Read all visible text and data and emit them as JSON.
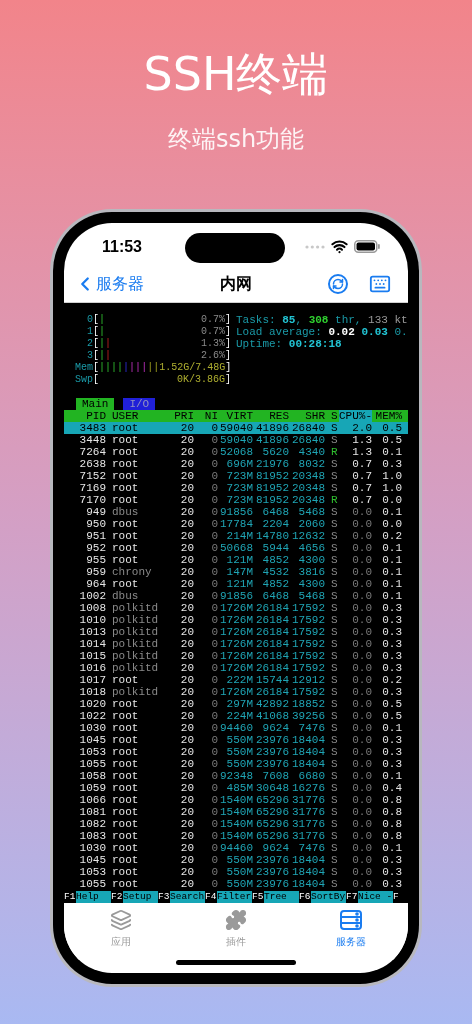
{
  "headline": "SSH终端",
  "subtitle": "终端ssh功能",
  "status_bar": {
    "time": "11:53"
  },
  "nav": {
    "back": "服务器",
    "title": "内网"
  },
  "terminal": {
    "meters": [
      {
        "label": "0",
        "open": "[",
        "bars": "|",
        "value": "0.7%",
        "close": "]",
        "kind": "cpu"
      },
      {
        "label": "1",
        "open": "[",
        "bars": "|",
        "value": "0.7%",
        "close": "]",
        "kind": "cpu"
      },
      {
        "label": "2",
        "open": "[",
        "bars": "||",
        "value": "1.3%",
        "close": "]",
        "kind": "cpu"
      },
      {
        "label": "3",
        "open": "[",
        "bars": "||",
        "value": "2.6%",
        "close": "]",
        "kind": "cpu"
      },
      {
        "label": "Mem",
        "open": "[",
        "bars": "||||||||||",
        "value": "1.52G/7.48G",
        "close": "]",
        "kind": "mem"
      },
      {
        "label": "Swp",
        "open": "[",
        "value": "0K/3.86G",
        "close": "]",
        "kind": "mem"
      }
    ],
    "summary": [
      {
        "segments": [
          {
            "text": "Tasks: ",
            "kind": "label"
          },
          {
            "text": "85",
            "kind": "value"
          },
          {
            "text": ", ",
            "kind": "label"
          },
          {
            "text": "308",
            "kind": "hot"
          },
          {
            "text": " thr, ",
            "kind": "label"
          },
          {
            "text": "133 kt",
            "kind": "muted"
          }
        ]
      },
      {
        "segments": [
          {
            "text": "Load average: ",
            "kind": "label"
          },
          {
            "text": "0.02 ",
            "kind": "bright"
          },
          {
            "text": "0.03 ",
            "kind": "value"
          },
          {
            "text": "0.",
            "kind": "label"
          }
        ]
      },
      {
        "segments": [
          {
            "text": "Uptime: ",
            "kind": "label"
          },
          {
            "text": "00:28:18",
            "kind": "value"
          }
        ]
      }
    ],
    "tabs": [
      {
        "label": "Main",
        "selected": true
      },
      {
        "label": "I/O",
        "selected": false
      }
    ],
    "columns": [
      {
        "label": "PID",
        "sorted": false
      },
      {
        "label": "USER",
        "sorted": false
      },
      {
        "label": "PRI",
        "sorted": false
      },
      {
        "label": "NI",
        "sorted": false
      },
      {
        "label": "VIRT",
        "sorted": false
      },
      {
        "label": "RES",
        "sorted": false
      },
      {
        "label": "SHR",
        "sorted": false
      },
      {
        "label": "S",
        "sorted": false
      },
      {
        "label": "CPU%-",
        "sorted": true
      },
      {
        "label": "MEM%",
        "sorted": false
      }
    ],
    "rows": [
      {
        "pid": "3483",
        "user": "root",
        "pri": "20",
        "ni": "0",
        "virt": "59040",
        "res": "41896",
        "shr": "26840",
        "s": "S",
        "cpu": "2.0",
        "mem": "0.5",
        "selected": true,
        "system": false,
        "running": false,
        "idle": false
      },
      {
        "pid": "3448",
        "user": "root",
        "pri": "20",
        "ni": "0",
        "virt": "59040",
        "res": "41896",
        "shr": "26840",
        "s": "S",
        "cpu": "1.3",
        "mem": "0.5",
        "selected": false,
        "system": false,
        "running": false,
        "idle": false
      },
      {
        "pid": "7264",
        "user": "root",
        "pri": "20",
        "ni": "0",
        "virt": "52068",
        "res": "5620",
        "shr": "4340",
        "s": "R",
        "cpu": "1.3",
        "mem": "0.1",
        "selected": false,
        "system": false,
        "running": true,
        "idle": false
      },
      {
        "pid": "2638",
        "user": "root",
        "pri": "20",
        "ni": "0",
        "virt": "696M",
        "res": "21976",
        "shr": "8032",
        "s": "S",
        "cpu": "0.7",
        "mem": "0.3",
        "selected": false,
        "system": false,
        "running": false,
        "idle": false
      },
      {
        "pid": "7152",
        "user": "root",
        "pri": "20",
        "ni": "0",
        "virt": "723M",
        "res": "81952",
        "shr": "20348",
        "s": "S",
        "cpu": "0.7",
        "mem": "1.0",
        "selected": false,
        "system": false,
        "running": false,
        "idle": false
      },
      {
        "pid": "7169",
        "user": "root",
        "pri": "20",
        "ni": "0",
        "virt": "723M",
        "res": "81952",
        "shr": "20348",
        "s": "S",
        "cpu": "0.7",
        "mem": "1.0",
        "selected": false,
        "system": false,
        "running": false,
        "idle": false
      },
      {
        "pid": "7170",
        "user": "root",
        "pri": "20",
        "ni": "0",
        "virt": "723M",
        "res": "81952",
        "shr": "20348",
        "s": "R",
        "cpu": "0.7",
        "mem": "0.0",
        "selected": false,
        "system": false,
        "running": true,
        "idle": false
      },
      {
        "pid": "949",
        "user": "dbus",
        "pri": "20",
        "ni": "0",
        "virt": "91856",
        "res": "6468",
        "shr": "5468",
        "s": "S",
        "cpu": "0.0",
        "mem": "0.1",
        "selected": false,
        "system": true,
        "running": false,
        "idle": true
      },
      {
        "pid": "950",
        "user": "root",
        "pri": "20",
        "ni": "0",
        "virt": "17784",
        "res": "2204",
        "shr": "2060",
        "s": "S",
        "cpu": "0.0",
        "mem": "0.0",
        "selected": false,
        "system": false,
        "running": false,
        "idle": true
      },
      {
        "pid": "951",
        "user": "root",
        "pri": "20",
        "ni": "0",
        "virt": "214M",
        "res": "14780",
        "shr": "12632",
        "s": "S",
        "cpu": "0.0",
        "mem": "0.2",
        "selected": false,
        "system": false,
        "running": false,
        "idle": true
      },
      {
        "pid": "952",
        "user": "root",
        "pri": "20",
        "ni": "0",
        "virt": "50668",
        "res": "5944",
        "shr": "4656",
        "s": "S",
        "cpu": "0.0",
        "mem": "0.1",
        "selected": false,
        "system": false,
        "running": false,
        "idle": true
      },
      {
        "pid": "955",
        "user": "root",
        "pri": "20",
        "ni": "0",
        "virt": "121M",
        "res": "4852",
        "shr": "4300",
        "s": "S",
        "cpu": "0.0",
        "mem": "0.1",
        "selected": false,
        "system": false,
        "running": false,
        "idle": true
      },
      {
        "pid": "959",
        "user": "chrony",
        "pri": "20",
        "ni": "0",
        "virt": "147M",
        "res": "4532",
        "shr": "3816",
        "s": "S",
        "cpu": "0.0",
        "mem": "0.1",
        "selected": false,
        "system": true,
        "running": false,
        "idle": true
      },
      {
        "pid": "964",
        "user": "root",
        "pri": "20",
        "ni": "0",
        "virt": "121M",
        "res": "4852",
        "shr": "4300",
        "s": "S",
        "cpu": "0.0",
        "mem": "0.1",
        "selected": false,
        "system": false,
        "running": false,
        "idle": true
      },
      {
        "pid": "1002",
        "user": "dbus",
        "pri": "20",
        "ni": "0",
        "virt": "91856",
        "res": "6468",
        "shr": "5468",
        "s": "S",
        "cpu": "0.0",
        "mem": "0.1",
        "selected": false,
        "system": true,
        "running": false,
        "idle": true
      },
      {
        "pid": "1008",
        "user": "polkitd",
        "pri": "20",
        "ni": "0",
        "virt": "1726M",
        "res": "26184",
        "shr": "17592",
        "s": "S",
        "cpu": "0.0",
        "mem": "0.3",
        "selected": false,
        "system": true,
        "running": false,
        "idle": true
      },
      {
        "pid": "1010",
        "user": "polkitd",
        "pri": "20",
        "ni": "0",
        "virt": "1726M",
        "res": "26184",
        "shr": "17592",
        "s": "S",
        "cpu": "0.0",
        "mem": "0.3",
        "selected": false,
        "system": true,
        "running": false,
        "idle": true
      },
      {
        "pid": "1013",
        "user": "polkitd",
        "pri": "20",
        "ni": "0",
        "virt": "1726M",
        "res": "26184",
        "shr": "17592",
        "s": "S",
        "cpu": "0.0",
        "mem": "0.3",
        "selected": false,
        "system": true,
        "running": false,
        "idle": true
      },
      {
        "pid": "1014",
        "user": "polkitd",
        "pri": "20",
        "ni": "0",
        "virt": "1726M",
        "res": "26184",
        "shr": "17592",
        "s": "S",
        "cpu": "0.0",
        "mem": "0.3",
        "selected": false,
        "system": true,
        "running": false,
        "idle": true
      },
      {
        "pid": "1015",
        "user": "polkitd",
        "pri": "20",
        "ni": "0",
        "virt": "1726M",
        "res": "26184",
        "shr": "17592",
        "s": "S",
        "cpu": "0.0",
        "mem": "0.3",
        "selected": false,
        "system": true,
        "running": false,
        "idle": true
      },
      {
        "pid": "1016",
        "user": "polkitd",
        "pri": "20",
        "ni": "0",
        "virt": "1726M",
        "res": "26184",
        "shr": "17592",
        "s": "S",
        "cpu": "0.0",
        "mem": "0.3",
        "selected": false,
        "system": true,
        "running": false,
        "idle": true
      },
      {
        "pid": "1017",
        "user": "root",
        "pri": "20",
        "ni": "0",
        "virt": "222M",
        "res": "15744",
        "shr": "12912",
        "s": "S",
        "cpu": "0.0",
        "mem": "0.2",
        "selected": false,
        "system": false,
        "running": false,
        "idle": true
      },
      {
        "pid": "1018",
        "user": "polkitd",
        "pri": "20",
        "ni": "0",
        "virt": "1726M",
        "res": "26184",
        "shr": "17592",
        "s": "S",
        "cpu": "0.0",
        "mem": "0.3",
        "selected": false,
        "system": true,
        "running": false,
        "idle": true
      },
      {
        "pid": "1020",
        "user": "root",
        "pri": "20",
        "ni": "0",
        "virt": "297M",
        "res": "42892",
        "shr": "18852",
        "s": "S",
        "cpu": "0.0",
        "mem": "0.5",
        "selected": false,
        "system": false,
        "running": false,
        "idle": true
      },
      {
        "pid": "1022",
        "user": "root",
        "pri": "20",
        "ni": "0",
        "virt": "224M",
        "res": "41068",
        "shr": "39256",
        "s": "S",
        "cpu": "0.0",
        "mem": "0.5",
        "selected": false,
        "system": false,
        "running": false,
        "idle": true
      },
      {
        "pid": "1030",
        "user": "root",
        "pri": "20",
        "ni": "0",
        "virt": "94460",
        "res": "9624",
        "shr": "7476",
        "s": "S",
        "cpu": "0.0",
        "mem": "0.1",
        "selected": false,
        "system": false,
        "running": false,
        "idle": true
      },
      {
        "pid": "1045",
        "user": "root",
        "pri": "20",
        "ni": "0",
        "virt": "550M",
        "res": "23976",
        "shr": "18404",
        "s": "S",
        "cpu": "0.0",
        "mem": "0.3",
        "selected": false,
        "system": false,
        "running": false,
        "idle": true
      },
      {
        "pid": "1053",
        "user": "root",
        "pri": "20",
        "ni": "0",
        "virt": "550M",
        "res": "23976",
        "shr": "18404",
        "s": "S",
        "cpu": "0.0",
        "mem": "0.3",
        "selected": false,
        "system": false,
        "running": false,
        "idle": true
      },
      {
        "pid": "1055",
        "user": "root",
        "pri": "20",
        "ni": "0",
        "virt": "550M",
        "res": "23976",
        "shr": "18404",
        "s": "S",
        "cpu": "0.0",
        "mem": "0.3",
        "selected": false,
        "system": false,
        "running": false,
        "idle": true
      },
      {
        "pid": "1058",
        "user": "root",
        "pri": "20",
        "ni": "0",
        "virt": "92348",
        "res": "7608",
        "shr": "6680",
        "s": "S",
        "cpu": "0.0",
        "mem": "0.1",
        "selected": false,
        "system": false,
        "running": false,
        "idle": true
      },
      {
        "pid": "1059",
        "user": "root",
        "pri": "20",
        "ni": "0",
        "virt": "485M",
        "res": "30648",
        "shr": "16276",
        "s": "S",
        "cpu": "0.0",
        "mem": "0.4",
        "selected": false,
        "system": false,
        "running": false,
        "idle": true
      },
      {
        "pid": "1066",
        "user": "root",
        "pri": "20",
        "ni": "0",
        "virt": "1540M",
        "res": "65296",
        "shr": "31776",
        "s": "S",
        "cpu": "0.0",
        "mem": "0.8",
        "selected": false,
        "system": false,
        "running": false,
        "idle": true
      },
      {
        "pid": "1081",
        "user": "root",
        "pri": "20",
        "ni": "0",
        "virt": "1540M",
        "res": "65296",
        "shr": "31776",
        "s": "S",
        "cpu": "0.0",
        "mem": "0.8",
        "selected": false,
        "system": false,
        "running": false,
        "idle": true
      },
      {
        "pid": "1082",
        "user": "root",
        "pri": "20",
        "ni": "0",
        "virt": "1540M",
        "res": "65296",
        "shr": "31776",
        "s": "S",
        "cpu": "0.0",
        "mem": "0.8",
        "selected": false,
        "system": false,
        "running": false,
        "idle": true
      },
      {
        "pid": "1083",
        "user": "root",
        "pri": "20",
        "ni": "0",
        "virt": "1540M",
        "res": "65296",
        "shr": "31776",
        "s": "S",
        "cpu": "0.0",
        "mem": "0.8",
        "selected": false,
        "system": false,
        "running": false,
        "idle": true
      },
      {
        "pid": "1030",
        "user": "root",
        "pri": "20",
        "ni": "0",
        "virt": "94460",
        "res": "9624",
        "shr": "7476",
        "s": "S",
        "cpu": "0.0",
        "mem": "0.1",
        "selected": false,
        "system": false,
        "running": false,
        "idle": true
      },
      {
        "pid": "1045",
        "user": "root",
        "pri": "20",
        "ni": "0",
        "virt": "550M",
        "res": "23976",
        "shr": "18404",
        "s": "S",
        "cpu": "0.0",
        "mem": "0.3",
        "selected": false,
        "system": false,
        "running": false,
        "idle": true
      },
      {
        "pid": "1053",
        "user": "root",
        "pri": "20",
        "ni": "0",
        "virt": "550M",
        "res": "23976",
        "shr": "18404",
        "s": "S",
        "cpu": "0.0",
        "mem": "0.3",
        "selected": false,
        "system": false,
        "running": false,
        "idle": true
      },
      {
        "pid": "1055",
        "user": "root",
        "pri": "20",
        "ni": "0",
        "virt": "550M",
        "res": "23976",
        "shr": "18404",
        "s": "S",
        "cpu": "0.0",
        "mem": "0.3",
        "selected": false,
        "system": false,
        "running": false,
        "idle": true
      }
    ],
    "function_keys": [
      {
        "key": "F1",
        "label": "Help"
      },
      {
        "key": "F2",
        "label": "Setup"
      },
      {
        "key": "F3",
        "label": "Search"
      },
      {
        "key": "F4",
        "label": "Filter"
      },
      {
        "key": "F5",
        "label": "Tree"
      },
      {
        "key": "F6",
        "label": "SortBy"
      },
      {
        "key": "F7",
        "label": "Nice -"
      },
      {
        "key": "F"
      }
    ]
  },
  "tab_bar": [
    {
      "label": "应用",
      "kind": "apps",
      "selected": false
    },
    {
      "label": "插件",
      "kind": "plugins",
      "selected": false
    },
    {
      "label": "服务器",
      "kind": "servers",
      "selected": true
    }
  ]
}
